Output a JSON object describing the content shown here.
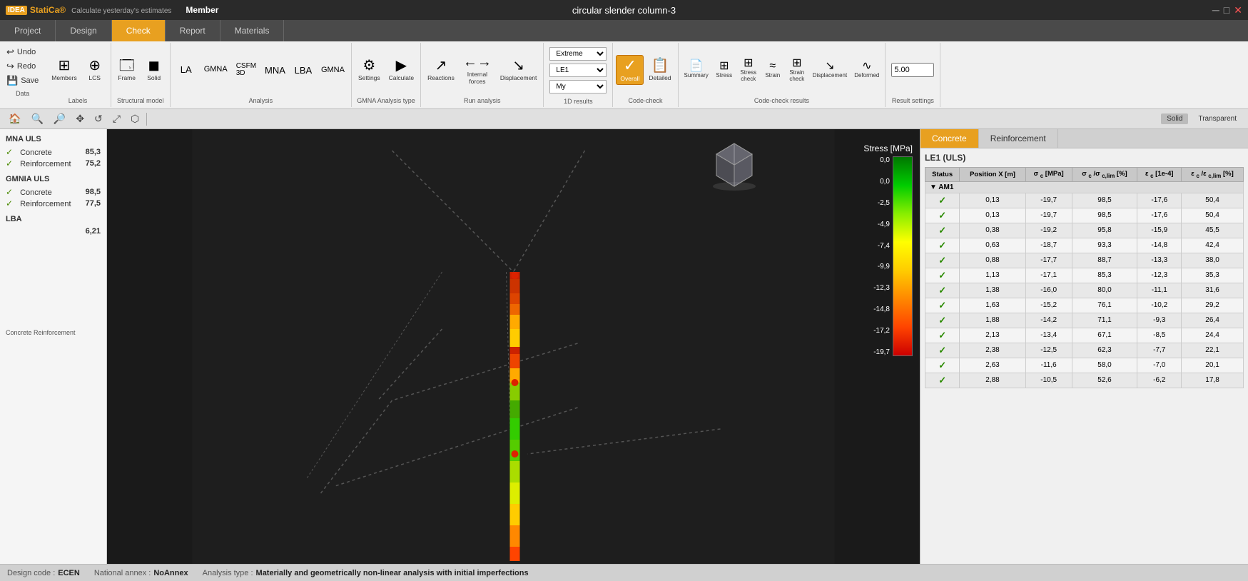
{
  "titleBar": {
    "title": "circular slender column-3",
    "logoText": "IDEA",
    "productName": "StatiCa®",
    "memberLabel": "Member",
    "tagline": "Calculate yesterday's estimates"
  },
  "navTabs": [
    {
      "id": "project",
      "label": "Project",
      "active": false
    },
    {
      "id": "design",
      "label": "Design",
      "active": false
    },
    {
      "id": "check",
      "label": "Check",
      "active": true
    },
    {
      "id": "report",
      "label": "Report",
      "active": false
    },
    {
      "id": "materials",
      "label": "Materials",
      "active": false
    }
  ],
  "ribbon": {
    "groups": [
      {
        "label": "Data",
        "buttons": [
          {
            "id": "undo",
            "icon": "↩",
            "label": "Undo"
          },
          {
            "id": "redo",
            "icon": "↪",
            "label": "Redo"
          },
          {
            "id": "save",
            "icon": "💾",
            "label": "Save"
          }
        ]
      },
      {
        "label": "Labels",
        "buttons": [
          {
            "id": "members",
            "icon": "⊞",
            "label": "Members"
          },
          {
            "id": "lcs",
            "icon": "⊕",
            "label": "LCS"
          }
        ]
      },
      {
        "label": "Structural model",
        "buttons": [
          {
            "id": "frame",
            "icon": "🗔",
            "label": "Frame"
          },
          {
            "id": "solid",
            "icon": "◼",
            "label": "Solid"
          },
          {
            "id": "la",
            "icon": "⊞",
            "label": "LA"
          },
          {
            "id": "gmna",
            "icon": "⊞",
            "label": "GMNA"
          },
          {
            "id": "csfm3d",
            "icon": "⊞",
            "label": "CSFM\n3D"
          },
          {
            "id": "mna",
            "icon": "⊞",
            "label": "MNA"
          },
          {
            "id": "lba",
            "icon": "⊞",
            "label": "LBA"
          },
          {
            "id": "gmna2",
            "icon": "⊞",
            "label": "GMNA"
          }
        ]
      },
      {
        "label": "Analysis",
        "buttons": []
      },
      {
        "label": "GMNA Analysis type",
        "buttons": [
          {
            "id": "settings",
            "icon": "⚙",
            "label": "Settings"
          },
          {
            "id": "calculate",
            "icon": "▶",
            "label": "Calculate"
          }
        ]
      },
      {
        "label": "Run analysis",
        "buttons": [
          {
            "id": "reactions",
            "icon": "↗",
            "label": "Reactions"
          },
          {
            "id": "internal-forces",
            "icon": "←",
            "label": "Internal\nforces"
          },
          {
            "id": "displacement",
            "icon": "↘",
            "label": "Displacement"
          }
        ]
      },
      {
        "label": "1D results",
        "dropdowns": [
          {
            "id": "extreme-select",
            "value": "Extreme"
          },
          {
            "id": "le1-select",
            "value": "LE1"
          },
          {
            "id": "my-select",
            "value": "My"
          }
        ]
      }
    ],
    "codeCheckGroup": {
      "label": "Code-check",
      "buttons": [
        {
          "id": "overall",
          "icon": "✓",
          "label": "Overall",
          "active": true
        },
        {
          "id": "detailed",
          "icon": "📋",
          "label": "Detailed",
          "active": false
        }
      ]
    },
    "codeCheckResultsGroup": {
      "label": "Code-check results",
      "buttons": [
        {
          "id": "summary",
          "icon": "📄",
          "label": "Summary"
        },
        {
          "id": "stress",
          "icon": "⊞",
          "label": "Stress"
        },
        {
          "id": "stress-check",
          "icon": "⊞",
          "label": "Stress\ncheck"
        },
        {
          "id": "strain",
          "icon": "≈",
          "label": "Strain"
        },
        {
          "id": "strain-check",
          "icon": "⊞",
          "label": "Strain\ncheck"
        },
        {
          "id": "displacement2",
          "icon": "↘",
          "label": "Displacement"
        },
        {
          "id": "deformed",
          "icon": "∿",
          "label": "Deformed"
        }
      ]
    },
    "resultSettings": {
      "label": "Result settings",
      "value": "5.00"
    }
  },
  "toolbar": {
    "buttons": [
      "🏠",
      "🔍",
      "🔎",
      "✥",
      "↺",
      "⤢",
      "⬡"
    ],
    "viewModes": [
      "Solid",
      "Transparent"
    ]
  },
  "leftPanel": {
    "sections": [
      {
        "title": "MNA ULS",
        "items": [
          {
            "label": "Concrete",
            "value": "85,3",
            "check": true
          },
          {
            "label": "Reinforcement",
            "value": "75,2",
            "check": true
          }
        ]
      },
      {
        "title": "GMNIA ULS",
        "items": [
          {
            "label": "Concrete",
            "value": "98,5",
            "check": true
          },
          {
            "label": "Reinforcement",
            "value": "77,5",
            "check": true
          }
        ]
      },
      {
        "title": "LBA",
        "items": [
          {
            "label": "",
            "value": "6,21",
            "check": false
          }
        ]
      }
    ]
  },
  "colorLegend": {
    "title": "Stress [MPa]",
    "labels": [
      "0,0",
      "0,0",
      "-2,5",
      "-4,9",
      "-7,4",
      "-9,9",
      "-12,3",
      "-14,8",
      "-17,2",
      "-19,7"
    ]
  },
  "rightPanel": {
    "tabs": [
      "Concrete",
      "Reinforcement"
    ],
    "activeTab": "Concrete",
    "leTitle": "LE1 (ULS)",
    "tableHeaders": [
      "Status",
      "Position X [m]",
      "σ c  [MPa]",
      "σ c /σ c,lim  [%]",
      "ε c  [1e-4]",
      "ε c /ε c,lim  [%]"
    ],
    "sections": [
      {
        "name": "AM1",
        "rows": [
          {
            "status": "✓",
            "pos": "0,13",
            "sigma": "-19,7",
            "sigmaPct": "98,5",
            "epsilon": "-17,6",
            "epsilonPct": "50,4"
          },
          {
            "status": "✓",
            "pos": "0,13",
            "sigma": "-19,7",
            "sigmaPct": "98,5",
            "epsilon": "-17,6",
            "epsilonPct": "50,4"
          },
          {
            "status": "✓",
            "pos": "0,38",
            "sigma": "-19,2",
            "sigmaPct": "95,8",
            "epsilon": "-15,9",
            "epsilonPct": "45,5"
          },
          {
            "status": "✓",
            "pos": "0,63",
            "sigma": "-18,7",
            "sigmaPct": "93,3",
            "epsilon": "-14,8",
            "epsilonPct": "42,4"
          },
          {
            "status": "✓",
            "pos": "0,88",
            "sigma": "-17,7",
            "sigmaPct": "88,7",
            "epsilon": "-13,3",
            "epsilonPct": "38,0"
          },
          {
            "status": "✓",
            "pos": "1,13",
            "sigma": "-17,1",
            "sigmaPct": "85,3",
            "epsilon": "-12,3",
            "epsilonPct": "35,3"
          },
          {
            "status": "✓",
            "pos": "1,38",
            "sigma": "-16,0",
            "sigmaPct": "80,0",
            "epsilon": "-11,1",
            "epsilonPct": "31,6"
          },
          {
            "status": "✓",
            "pos": "1,63",
            "sigma": "-15,2",
            "sigmaPct": "76,1",
            "epsilon": "-10,2",
            "epsilonPct": "29,2"
          },
          {
            "status": "✓",
            "pos": "1,88",
            "sigma": "-14,2",
            "sigmaPct": "71,1",
            "epsilon": "-9,3",
            "epsilonPct": "26,4"
          },
          {
            "status": "✓",
            "pos": "2,13",
            "sigma": "-13,4",
            "sigmaPct": "67,1",
            "epsilon": "-8,5",
            "epsilonPct": "24,4"
          },
          {
            "status": "✓",
            "pos": "2,38",
            "sigma": "-12,5",
            "sigmaPct": "62,3",
            "epsilon": "-7,7",
            "epsilonPct": "22,1"
          },
          {
            "status": "✓",
            "pos": "2,63",
            "sigma": "-11,6",
            "sigmaPct": "58,0",
            "epsilon": "-7,0",
            "epsilonPct": "20,1"
          },
          {
            "status": "✓",
            "pos": "2,88",
            "sigma": "-10,5",
            "sigmaPct": "52,6",
            "epsilon": "-6,2",
            "epsilonPct": "17,8"
          }
        ]
      }
    ]
  },
  "statusBar": {
    "designCode": {
      "label": "Design code :",
      "value": "ECEN"
    },
    "nationalAnnex": {
      "label": "National annex :",
      "value": "NoAnnex"
    },
    "analysisType": {
      "label": "Analysis type :",
      "value": "Materially and geometrically non-linear analysis with initial imperfections"
    }
  }
}
